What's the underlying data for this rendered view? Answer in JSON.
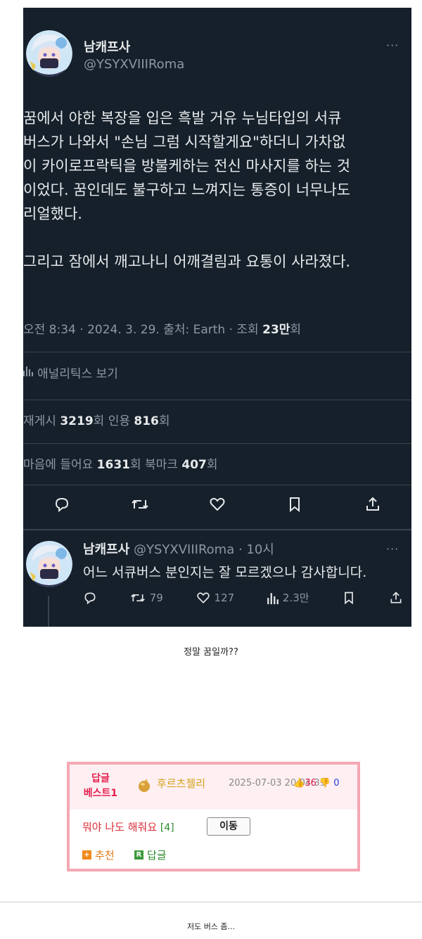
{
  "tweet": {
    "author_name": "남캐프사",
    "author_handle": "@YSYXVIIIRoma",
    "more_label": "···",
    "body_paragraph_1": "꿈에서 야한 복장을 입은 흑발 거유 누님타입의 서큐\n버스가 나와서 \"손님 그럼 시작할게요\"하더니 가차없\n이 카이로프락틱을 방불케하는 전신 마사지를 하는 것\n이었다. 꿈인데도 불구하고 느껴지는 통증이 너무나도\n리얼했다.",
    "body_paragraph_2": "그리고 잠에서 깨고나니 어깨결림과 요통이 사라졌다.",
    "meta_prefix": "오전 8:34 · 2024. 3. 29. 출처: Earth · 조회 ",
    "meta_views": "23만",
    "meta_suffix": "회",
    "analytics_label": "애널리틱스 보기",
    "retweets_label": "재게시 ",
    "retweets_value": "3219",
    "retweets_unit": "회  인용 ",
    "quotes_value": "816",
    "quotes_unit": "회",
    "likes_label": "마음에 들어요 ",
    "likes_value": "1631",
    "likes_unit": "회  북마크 ",
    "bookmarks_value": "407",
    "bookmarks_unit": "회"
  },
  "reply": {
    "author_name": "남캐프사",
    "author_handle": " @YSYXVIIIRoma · 10시",
    "more_label": "···",
    "text": "어느 서큐버스 분인지는 잘 모르겠으나 감사합니다.",
    "retweets": "79",
    "likes": "127",
    "views": "2.3만"
  },
  "caption": "정말 꿈일까??",
  "best_reply": {
    "label_line1": "답글",
    "label_line2": "베스트1",
    "author": "후르츠젤리",
    "date": "2025-07-03 20:04:39",
    "upvotes": "36",
    "downvotes": "0",
    "comment": "뭐야 나도 해줘요",
    "comment_count": "[4]",
    "move_label": "이동",
    "recommend_label": "추천",
    "reply_label": "답글"
  },
  "next_caption": "저도 버스 좀...",
  "colors": {
    "tweet_bg": "#15202b",
    "best_border": "#f4a8b3",
    "best_label": "#e8214f",
    "author_gold": "#d5a017"
  }
}
